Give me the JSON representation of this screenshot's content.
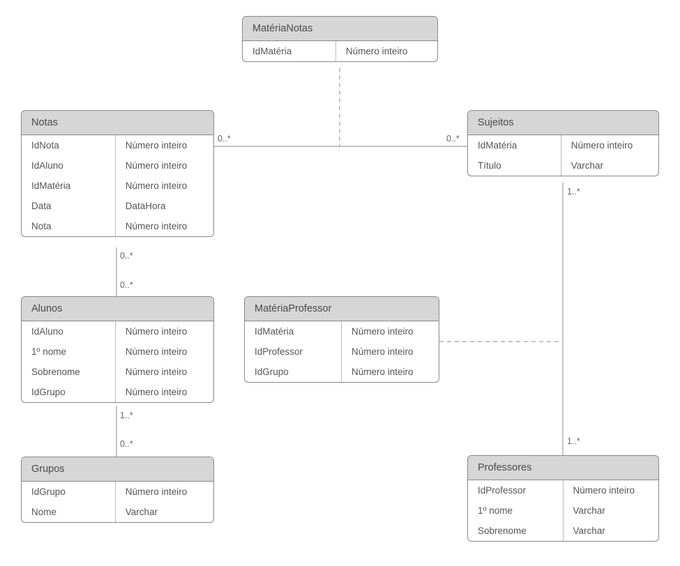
{
  "entities": {
    "materiaNotas": {
      "title": "MatériaNotas",
      "rows": [
        {
          "name": "IdMatéria",
          "type": "Número inteiro"
        }
      ]
    },
    "notas": {
      "title": "Notas",
      "rows": [
        {
          "name": "IdNota",
          "type": "Número inteiro"
        },
        {
          "name": "IdAluno",
          "type": "Número inteiro"
        },
        {
          "name": "IdMatéria",
          "type": "Número inteiro"
        },
        {
          "name": "Data",
          "type": "DataHora"
        },
        {
          "name": "Nota",
          "type": "Número inteiro"
        }
      ]
    },
    "sujeitos": {
      "title": "Sujeitos",
      "rows": [
        {
          "name": "IdMatéria",
          "type": "Número inteiro"
        },
        {
          "name": "Título",
          "type": "Varchar"
        }
      ]
    },
    "alunos": {
      "title": "Alunos",
      "rows": [
        {
          "name": "IdAluno",
          "type": "Número inteiro"
        },
        {
          "name": "1º nome",
          "type": "Número inteiro"
        },
        {
          "name": "Sobrenome",
          "type": "Número inteiro"
        },
        {
          "name": "IdGrupo",
          "type": "Número inteiro"
        }
      ]
    },
    "materiaProfessor": {
      "title": "MatériaProfessor",
      "rows": [
        {
          "name": "IdMatéria",
          "type": "Número inteiro"
        },
        {
          "name": "IdProfessor",
          "type": "Número inteiro"
        },
        {
          "name": "IdGrupo",
          "type": "Número inteiro"
        }
      ]
    },
    "grupos": {
      "title": "Grupos",
      "rows": [
        {
          "name": "IdGrupo",
          "type": "Número inteiro"
        },
        {
          "name": "Nome",
          "type": "Varchar"
        }
      ]
    },
    "professores": {
      "title": "Professores",
      "rows": [
        {
          "name": "IdProfessor",
          "type": "Número inteiro"
        },
        {
          "name": "1º nome",
          "type": "Varchar"
        },
        {
          "name": "Sobrenome",
          "type": "Varchar"
        }
      ]
    }
  },
  "cardinalities": {
    "notas_right": "0..*",
    "sujeitos_left": "0..*",
    "sujeitos_bottom": "1..*",
    "notas_bottom": "0..*",
    "alunos_top": "0..*",
    "alunos_bottom": "1..*",
    "grupos_top": "0..*",
    "professores_top": "1..*"
  }
}
